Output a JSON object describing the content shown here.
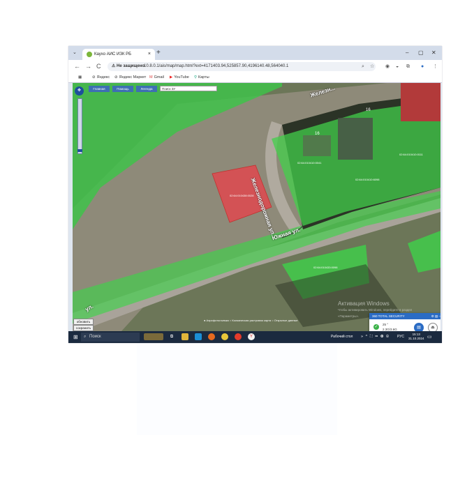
{
  "browser": {
    "tab_title": "Каухо АИС ИЗК РБ",
    "tab_close": "×",
    "new_tab": "+",
    "tab_list": "⌄",
    "window_controls": [
      "–",
      "▢",
      "✕"
    ],
    "nav": [
      "←",
      "→",
      "C"
    ],
    "security_warning": "⚠ Не защищено",
    "url": "10.8.0.1/ais/map/map.html?ext=4171403.94,525857.90,4196140.48,564040.1",
    "toolbar_icons": [
      "⌕",
      "☆",
      "◉",
      "◒",
      "⧉",
      "●",
      "⋮"
    ]
  },
  "bookmarks": [
    {
      "icon": "▦",
      "label": ""
    },
    {
      "icon": "⊘",
      "label": "Яндекс"
    },
    {
      "icon": "⊘",
      "label": "Яндекс Маркет"
    },
    {
      "icon": "M",
      "label": "Gmail"
    },
    {
      "icon": "▶",
      "label": "YouTube"
    },
    {
      "icon": "⚲",
      "label": "Карты"
    }
  ],
  "map": {
    "top_tabs": [
      "Главная",
      "Помощь",
      "Легенда"
    ],
    "search_value": "Поиск ЗУ",
    "pan_icon": "✥",
    "side_buttons": [
      "обновить",
      "сохранить"
    ],
    "streets": [
      "Железн...",
      "Железнодорожная ул.",
      "Южная ул.",
      "ул."
    ],
    "house_numbers": [
      "16",
      "16"
    ],
    "parcel_labels": [
      "02:64:010438:0028",
      "02:64:010410:0041",
      "02:64:010410:6098",
      "02:64:010410:0111",
      "02:64:010433:0098"
    ],
    "layers_text": "● Аэрофотосъемка   ○ Космическая растровая карта   ○ Открытые данные",
    "scale_text": [
      "Масштаб 1 : 1000",
      "4171401.00 Y=542395.00 X"
    ],
    "activate_title": "Активация Windows",
    "activate_sub": "Чтобы активировать Windows, перейдите в раздел «Параметры»."
  },
  "security_popup": {
    "title": "360 TOTAL SECURITY",
    "header_icons": "⚙ ▤ –",
    "check": "✓",
    "line1": "25 °",
    "line2": "2.3G/3.6G",
    "btn1": "▤",
    "btn2": "⏏"
  },
  "taskbar": {
    "start": "⊞",
    "search_icon": "⌕",
    "search_placeholder": "Поиск",
    "desktop_label": "Рабочий стол",
    "tray_icons": "» ^ ⛶ ▭ ◍ ⊛ ",
    "lang": "РУС",
    "time": "15:13",
    "date": "31.10.2024",
    "notifications": "▭"
  },
  "colors": {
    "overlay_green": "#3fd24a",
    "parcel_red": "#e0494f",
    "taskbar": "#1b2a3f",
    "accent": "#2b6cc4"
  }
}
